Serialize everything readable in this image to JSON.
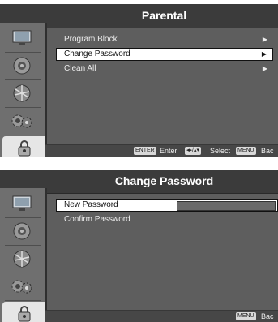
{
  "screens": [
    {
      "title": "Parental",
      "items": [
        {
          "label": "Program Block",
          "arrow": "▶"
        },
        {
          "label": "Change Password",
          "arrow": "▶"
        },
        {
          "label": "Clean All",
          "arrow": "▶"
        }
      ],
      "footer": {
        "enter_key": "ENTER",
        "enter_label": "Enter",
        "select_key": "◂▸/▴▾",
        "select_label": "Select",
        "menu_key": "MENU",
        "menu_label": "Bac"
      }
    },
    {
      "title": "Change Password",
      "items": [
        {
          "label": "New Password"
        },
        {
          "label": "Confirm Password"
        }
      ],
      "footer": {
        "menu_key": "MENU",
        "menu_label": "Bac"
      }
    }
  ],
  "sidebar_icons": [
    "picture-icon",
    "sound-icon",
    "channel-icon",
    "setup-icon",
    "lock-icon"
  ],
  "colors": {
    "panel": "#5e5e5e",
    "title_bar": "#3b3b3b",
    "highlight": "#ffffff"
  }
}
